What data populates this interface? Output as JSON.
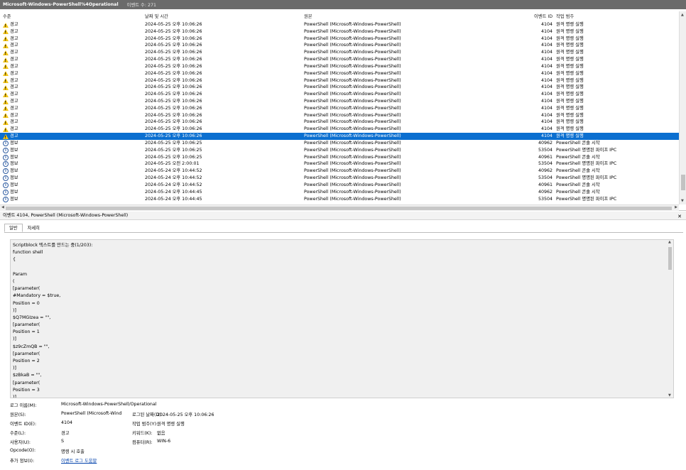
{
  "window": {
    "log_name": "Microsoft-Windows-PowerShell%4Operational",
    "event_count": "이벤트 수: 271"
  },
  "columns": {
    "level": "수준",
    "datetime": "날짜 및 시간",
    "source": "원본",
    "event_id": "이벤트 ID",
    "task_category": "작업 범주"
  },
  "icons": {
    "warning": "warning-icon",
    "info": "info-icon"
  },
  "selected_row_index": 16,
  "events": [
    {
      "level": "경고",
      "type": "warning",
      "datetime": "2024-05-25 오후 10:06:26",
      "source": "PowerShell (Microsoft-Windows-PowerShell)",
      "id": "4104",
      "category": "원격 명령 실행"
    },
    {
      "level": "경고",
      "type": "warning",
      "datetime": "2024-05-25 오후 10:06:26",
      "source": "PowerShell (Microsoft-Windows-PowerShell)",
      "id": "4104",
      "category": "원격 명령 실행"
    },
    {
      "level": "경고",
      "type": "warning",
      "datetime": "2024-05-25 오후 10:06:26",
      "source": "PowerShell (Microsoft-Windows-PowerShell)",
      "id": "4104",
      "category": "원격 명령 실행"
    },
    {
      "level": "경고",
      "type": "warning",
      "datetime": "2024-05-25 오후 10:06:26",
      "source": "PowerShell (Microsoft-Windows-PowerShell)",
      "id": "4104",
      "category": "원격 명령 실행"
    },
    {
      "level": "경고",
      "type": "warning",
      "datetime": "2024-05-25 오후 10:06:26",
      "source": "PowerShell (Microsoft-Windows-PowerShell)",
      "id": "4104",
      "category": "원격 명령 실행"
    },
    {
      "level": "경고",
      "type": "warning",
      "datetime": "2024-05-25 오후 10:06:26",
      "source": "PowerShell (Microsoft-Windows-PowerShell)",
      "id": "4104",
      "category": "원격 명령 실행"
    },
    {
      "level": "경고",
      "type": "warning",
      "datetime": "2024-05-25 오후 10:06:26",
      "source": "PowerShell (Microsoft-Windows-PowerShell)",
      "id": "4104",
      "category": "원격 명령 실행"
    },
    {
      "level": "경고",
      "type": "warning",
      "datetime": "2024-05-25 오후 10:06:26",
      "source": "PowerShell (Microsoft-Windows-PowerShell)",
      "id": "4104",
      "category": "원격 명령 실행"
    },
    {
      "level": "경고",
      "type": "warning",
      "datetime": "2024-05-25 오후 10:06:26",
      "source": "PowerShell (Microsoft-Windows-PowerShell)",
      "id": "4104",
      "category": "원격 명령 실행"
    },
    {
      "level": "경고",
      "type": "warning",
      "datetime": "2024-05-25 오후 10:06:26",
      "source": "PowerShell (Microsoft-Windows-PowerShell)",
      "id": "4104",
      "category": "원격 명령 실행"
    },
    {
      "level": "경고",
      "type": "warning",
      "datetime": "2024-05-25 오후 10:06:26",
      "source": "PowerShell (Microsoft-Windows-PowerShell)",
      "id": "4104",
      "category": "원격 명령 실행"
    },
    {
      "level": "경고",
      "type": "warning",
      "datetime": "2024-05-25 오후 10:06:26",
      "source": "PowerShell (Microsoft-Windows-PowerShell)",
      "id": "4104",
      "category": "원격 명령 실행"
    },
    {
      "level": "경고",
      "type": "warning",
      "datetime": "2024-05-25 오후 10:06:26",
      "source": "PowerShell (Microsoft-Windows-PowerShell)",
      "id": "4104",
      "category": "원격 명령 실행"
    },
    {
      "level": "경고",
      "type": "warning",
      "datetime": "2024-05-25 오후 10:06:26",
      "source": "PowerShell (Microsoft-Windows-PowerShell)",
      "id": "4104",
      "category": "원격 명령 실행"
    },
    {
      "level": "경고",
      "type": "warning",
      "datetime": "2024-05-25 오후 10:06:26",
      "source": "PowerShell (Microsoft-Windows-PowerShell)",
      "id": "4104",
      "category": "원격 명령 실행"
    },
    {
      "level": "경고",
      "type": "warning",
      "datetime": "2024-05-25 오후 10:06:26",
      "source": "PowerShell (Microsoft-Windows-PowerShell)",
      "id": "4104",
      "category": "원격 명령 실행"
    },
    {
      "level": "경고",
      "type": "warning",
      "datetime": "2024-05-25 오후 10:06:26",
      "source": "PowerShell (Microsoft-Windows-PowerShell)",
      "id": "4104",
      "category": "원격 명령 실행"
    },
    {
      "level": "정보",
      "type": "info",
      "datetime": "2024-05-25 오후 10:06:25",
      "source": "PowerShell (Microsoft-Windows-PowerShell)",
      "id": "40962",
      "category": "PowerShell 콘솔 시작"
    },
    {
      "level": "정보",
      "type": "info",
      "datetime": "2024-05-25 오후 10:06:25",
      "source": "PowerShell (Microsoft-Windows-PowerShell)",
      "id": "53504",
      "category": "PowerShell 명명된 파이프 IPC"
    },
    {
      "level": "정보",
      "type": "info",
      "datetime": "2024-05-25 오후 10:06:25",
      "source": "PowerShell (Microsoft-Windows-PowerShell)",
      "id": "40961",
      "category": "PowerShell 콘솔 시작"
    },
    {
      "level": "정보",
      "type": "info",
      "datetime": "2024-05-25 오전 2:00:01",
      "source": "PowerShell (Microsoft-Windows-PowerShell)",
      "id": "53504",
      "category": "PowerShell 명명된 파이프 IPC"
    },
    {
      "level": "정보",
      "type": "info",
      "datetime": "2024-05-24 오후 10:44:52",
      "source": "PowerShell (Microsoft-Windows-PowerShell)",
      "id": "40962",
      "category": "PowerShell 콘솔 시작"
    },
    {
      "level": "정보",
      "type": "info",
      "datetime": "2024-05-24 오후 10:44:52",
      "source": "PowerShell (Microsoft-Windows-PowerShell)",
      "id": "53504",
      "category": "PowerShell 명명된 파이프 IPC"
    },
    {
      "level": "정보",
      "type": "info",
      "datetime": "2024-05-24 오후 10:44:52",
      "source": "PowerShell (Microsoft-Windows-PowerShell)",
      "id": "40961",
      "category": "PowerShell 콘솔 시작"
    },
    {
      "level": "정보",
      "type": "info",
      "datetime": "2024-05-24 오후 10:44:45",
      "source": "PowerShell (Microsoft-Windows-PowerShell)",
      "id": "40962",
      "category": "PowerShell 콘솔 시작"
    },
    {
      "level": "정보",
      "type": "info",
      "datetime": "2024-05-24 오후 10:44:45",
      "source": "PowerShell (Microsoft-Windows-PowerShell)",
      "id": "53504",
      "category": "PowerShell 명명된 파이프 IPC"
    }
  ],
  "details": {
    "title": "이벤트 4104, PowerShell (Microsoft-Windows-PowerShell)",
    "tab_general": "일반",
    "tab_details": "자세히",
    "message_lines": [
      "Scriptblock 텍스트를 만드는 중(1/203):",
      "function shell",
      "{",
      "",
      "Param",
      "(",
      "[parameter(",
      "#Mandatory = $true,",
      "Position = 0",
      ")]",
      "$Q7MGIzea = \"\",",
      "[parameter(",
      "Position = 1",
      ")]",
      "$z9cZmQB = \"\",",
      "[parameter(",
      "Position = 2",
      ")]",
      "$zBkaB = \"\",",
      "[parameter(",
      "Position = 3",
      ")]",
      "$Kishko = \"\""
    ],
    "props": {
      "log_name_label": "로그 이름(M):",
      "log_name_value": "Microsoft-Windows-PowerShell/Operational",
      "source_label": "원본(S):",
      "source_value": "PowerShell (Microsoft-Wind",
      "logged_label": "로그된 날짜(D):",
      "logged_value": "2024-05-25 오후 10:06:26",
      "event_id_label": "이벤트 ID(E):",
      "event_id_value": "4104",
      "task_label": "작업 범주(Y):",
      "task_value": "원격 명령 실행",
      "level_label": "수준(L):",
      "level_value": "경고",
      "keywords_label": "키워드(K):",
      "keywords_value": "없음",
      "user_label": "사용자(U):",
      "user_value": "S",
      "computer_label": "컴퓨터(R):",
      "computer_value": "WIN-6",
      "opcode_label": "Opcode(O):",
      "opcode_value": "명령 시 호출",
      "more_info_label": "추가 정보(I):",
      "more_info_link": "이벤트 로그 도움말"
    }
  },
  "colors": {
    "titlebar": "#6b6b6b",
    "selection": "#0b6fd0",
    "warning": "#f2c417",
    "info": "#2c5aa0",
    "link": "#0645ad"
  }
}
